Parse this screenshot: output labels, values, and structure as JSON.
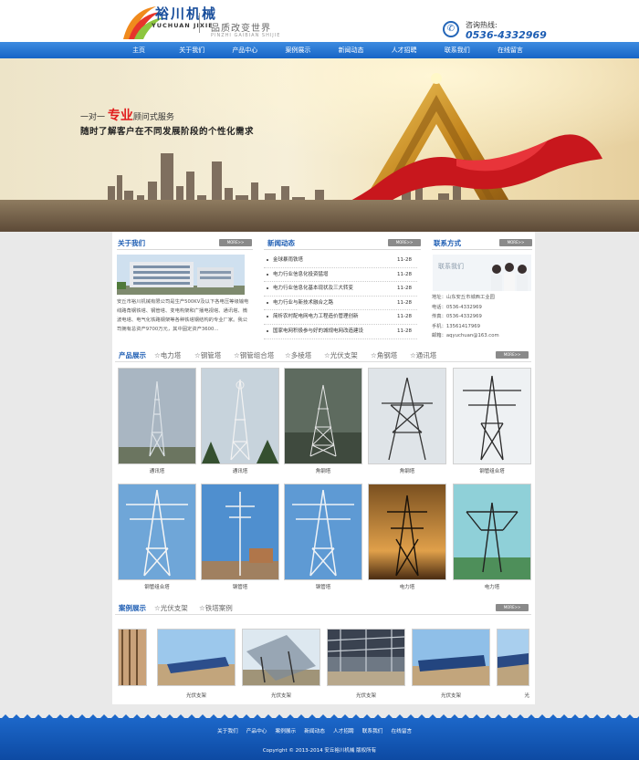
{
  "header": {
    "logo_cn": "裕川机械",
    "logo_en": "YUCHUAN JIXIE",
    "slogan": "品质改变世界",
    "slogan_pinyin": "PINZHI GAIBIAN SHIJIE",
    "hotline_label": "咨询热线:",
    "hotline_number": "0536-4332969"
  },
  "nav": [
    "主页",
    "关于我们",
    "产品中心",
    "案例展示",
    "新闻动态",
    "人才招聘",
    "联系我们",
    "在线留言"
  ],
  "banner": {
    "line1_pre": "一对一",
    "line1_highlight": "专业",
    "line1_post": "顾问式服务",
    "line2": "随时了解客户在不同发展阶段的个性化需求"
  },
  "about": {
    "title": "关于我们",
    "more": "MORE>>",
    "text": "安丘市裕川机械有限公司是生产500KV及以下各电压等级输电线路角钢铁塔、钢管塔、变电构架和广播电视塔、通讯塔、微波电塔、电气化铁路钢架等各种铁塔钢结构的专业厂家。我公司拥有总资产9700万元，其中固定资产3600..."
  },
  "news": {
    "title": "新闻动态",
    "more": "MORE>>",
    "items": [
      {
        "title": "金球暴雨铁塔",
        "date": "11-28"
      },
      {
        "title": "电力行业信息化投资猛增",
        "date": "11-28"
      },
      {
        "title": "电力行业信息化基本现状及三大转变",
        "date": "11-28"
      },
      {
        "title": "电力行业与新技术融合之路",
        "date": "11-28"
      },
      {
        "title": "简析农村配电网电力工程造价管理创新",
        "date": "11-28"
      },
      {
        "title": "国家电网积极参与好的城规电网改造建设",
        "date": "11-28"
      }
    ]
  },
  "contact": {
    "title": "联系方式",
    "more": "MORE>>",
    "photo_label": "联系我们",
    "lines": [
      "地址：山东安丘市城西工业园",
      "电话：0536-4332969",
      "传真：0536-4332969",
      "手机：13561417969",
      "邮箱：aqyuchuan@163.com"
    ]
  },
  "products": {
    "tabs": [
      "产品展示",
      "☆电力塔",
      "☆钢管塔",
      "☆钢管组合塔",
      "☆多棱塔",
      "☆光伏支架",
      "☆角钢塔",
      "☆通讯塔"
    ],
    "more": "MORE>>",
    "items": [
      "通讯塔",
      "通讯塔",
      "角钢塔",
      "角钢塔",
      "钢管组合塔",
      "钢管组合塔",
      "钢管塔",
      "钢管塔",
      "电力塔",
      "电力塔"
    ]
  },
  "cases": {
    "tabs": [
      "案例展示",
      "☆光伏支架",
      "☆铁塔案例"
    ],
    "more": "MORE>>",
    "items": [
      "",
      "光伏支架",
      "光伏支架",
      "光伏支架",
      "光伏支架",
      "光"
    ]
  },
  "footer": {
    "links": [
      "关于我们",
      "产品中心",
      "案例展示",
      "新闻动态",
      "人才招聘",
      "联系我们",
      "在线留言"
    ],
    "copyright": "Copyright © 2013-2014 安丘裕川机械 版权所有"
  },
  "colors": {
    "brand_blue": "#1665c6",
    "accent_red": "#e11c1c",
    "footer_blue": "#0d4aa3"
  }
}
